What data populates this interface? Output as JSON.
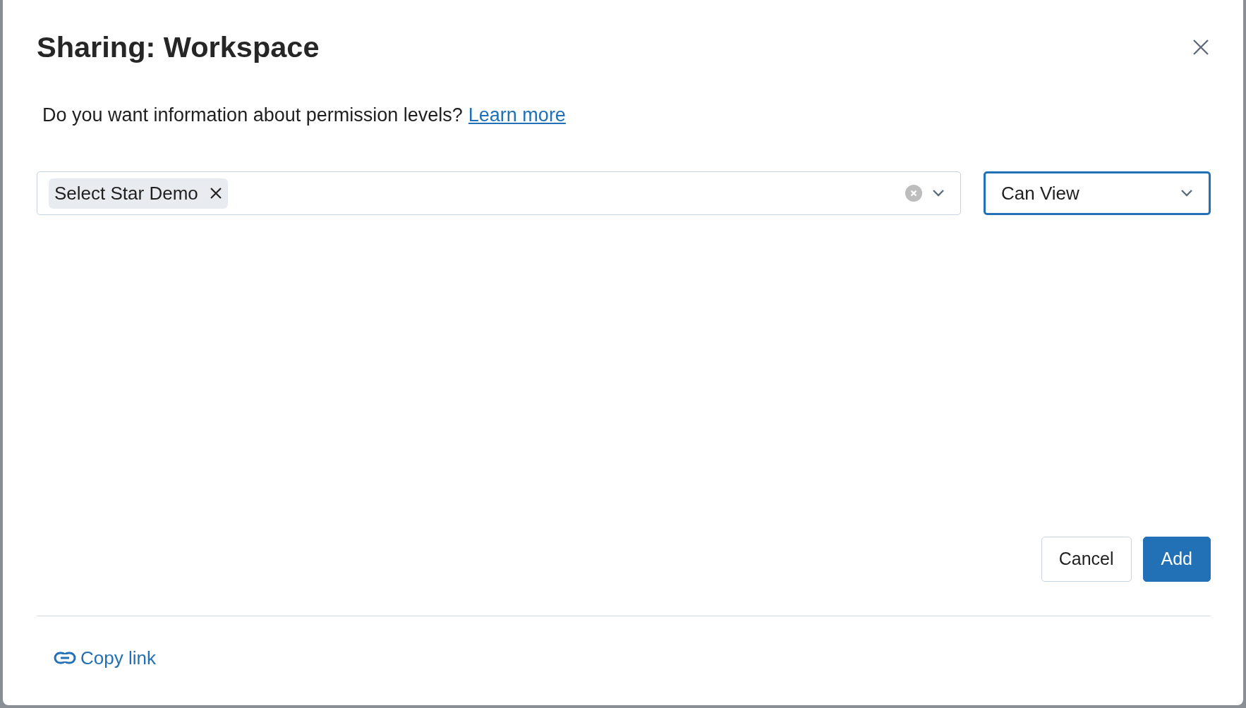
{
  "dialog": {
    "title": "Sharing: Workspace",
    "info_text": "Do you want information about permission levels?",
    "info_link": "Learn more"
  },
  "principals_field": {
    "tags": [
      {
        "label": "Select Star Demo"
      }
    ]
  },
  "permission_select": {
    "value": "Can View",
    "focused": true
  },
  "buttons": [
    {
      "label": "Cancel",
      "kind": "secondary"
    },
    {
      "label": "Add",
      "kind": "primary"
    }
  ],
  "footer": {
    "copy_link": "Copy link"
  }
}
